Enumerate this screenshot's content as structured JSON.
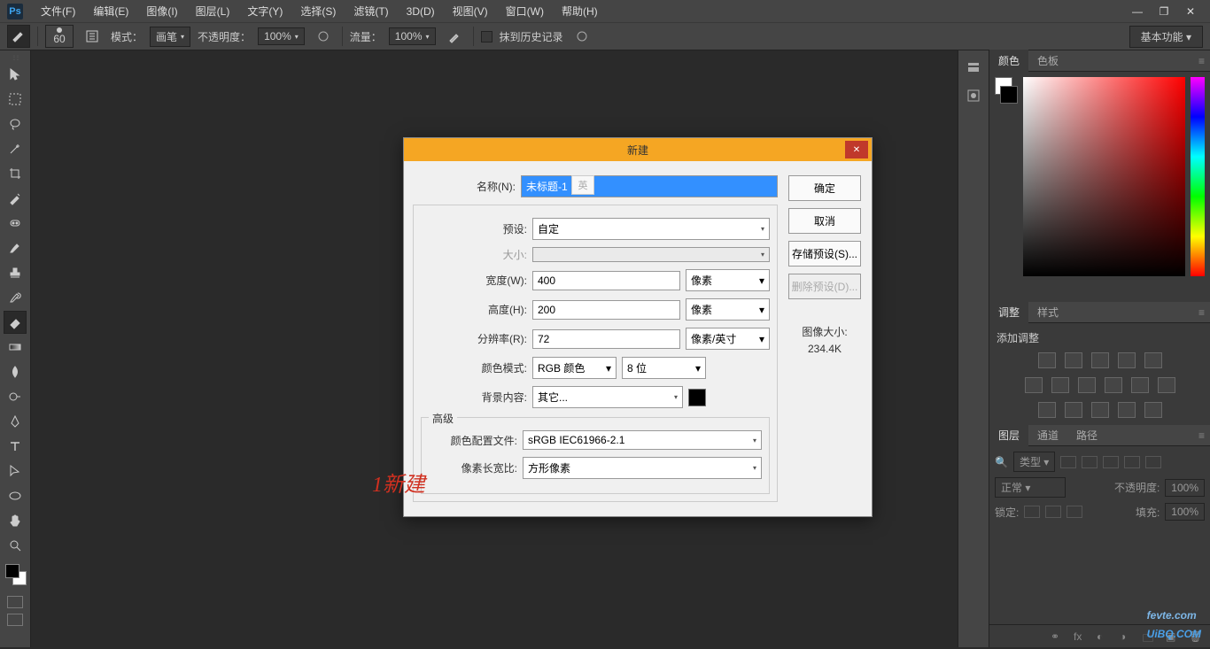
{
  "app": {
    "logo": "Ps"
  },
  "menu": [
    "文件(F)",
    "编辑(E)",
    "图像(I)",
    "图层(L)",
    "文字(Y)",
    "选择(S)",
    "滤镜(T)",
    "3D(D)",
    "视图(V)",
    "窗口(W)",
    "帮助(H)"
  ],
  "window_controls": {
    "min": "—",
    "max": "❐",
    "close": "✕"
  },
  "options": {
    "brush_size": "60",
    "mode_label": "模式：",
    "mode_value": "画笔",
    "opacity_label": "不透明度：",
    "opacity_value": "100%",
    "flow_label": "流量：",
    "flow_value": "100%",
    "erase_history": "抹到历史记录",
    "workspace": "基本功能"
  },
  "panels": {
    "color": {
      "tabs": [
        "颜色",
        "色板"
      ],
      "fg": "#ffffff",
      "bg": "#000000"
    },
    "adjust": {
      "tabs": [
        "调整",
        "样式"
      ],
      "title": "添加调整"
    },
    "layers": {
      "tabs": [
        "图层",
        "通道",
        "路径"
      ],
      "filter_label": "类型",
      "blend": "正常",
      "opacity_label": "不透明度:",
      "opacity_value": "100%",
      "lock_label": "锁定:",
      "fill_label": "填充:",
      "fill_value": "100%"
    }
  },
  "dialog": {
    "title": "新建",
    "name_label": "名称(N):",
    "name_value": "未标题-1",
    "preset_label": "预设:",
    "preset_value": "自定",
    "size_label": "大小:",
    "width_label": "宽度(W):",
    "width_value": "400",
    "width_unit": "像素",
    "height_label": "高度(H):",
    "height_value": "200",
    "height_unit": "像素",
    "res_label": "分辨率(R):",
    "res_value": "72",
    "res_unit": "像素/英寸",
    "mode_label": "颜色模式:",
    "mode_value": "RGB 颜色",
    "depth_value": "8 位",
    "bg_label": "背景内容:",
    "bg_value": "其它...",
    "adv": "高级",
    "profile_label": "颜色配置文件:",
    "profile_value": "sRGB IEC61966-2.1",
    "aspect_label": "像素长宽比:",
    "aspect_value": "方形像素",
    "btn_ok": "确定",
    "btn_cancel": "取消",
    "btn_save": "存储预设(S)...",
    "btn_del": "删除预设(D)...",
    "imgsize_label": "图像大小:",
    "imgsize_value": "234.4K",
    "ime": "英"
  },
  "annotation": "1新建",
  "watermark": {
    "top": "fevte.com",
    "mid": "UiBQ.COM"
  }
}
